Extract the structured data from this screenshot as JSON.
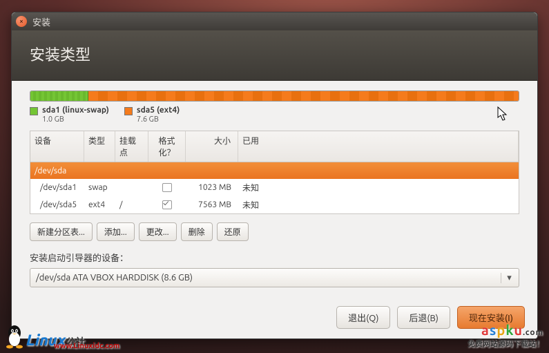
{
  "window": {
    "title": "安装"
  },
  "header": {
    "title": "安装类型"
  },
  "usage": {
    "sda1": {
      "label": "sda1 (linux-swap)",
      "size": "1.0 GB"
    },
    "sda5": {
      "label": "sda5 (ext4)",
      "size": "7.6 GB"
    }
  },
  "columns": {
    "device": "设备",
    "type": "类型",
    "mount": "挂载点",
    "format": "格式化？",
    "size": "大小",
    "used": "已用"
  },
  "rows": {
    "disk": {
      "device": "/dev/sda"
    },
    "p1": {
      "device": "/dev/sda1",
      "type": "swap",
      "mount": "",
      "size": "1023 MB",
      "used": "未知"
    },
    "p2": {
      "device": "/dev/sda5",
      "type": "ext4",
      "mount": "/",
      "size": "7563 MB",
      "used": "未知"
    }
  },
  "tableButtons": {
    "new": "新建分区表...",
    "add": "添加...",
    "change": "更改...",
    "delete": "删除",
    "revert": "还原"
  },
  "bootloader": {
    "label": "安装启动引导器的设备：",
    "value": "/dev/sda    ATA VBOX HARDDISK (8.6 GB)"
  },
  "footer": {
    "quit": "退出(Q)",
    "back": "后退(B)",
    "install": "现在安装(I)"
  },
  "watermarks": {
    "linuxidc": {
      "name": "Linux",
      "suffix": "公社",
      "url": "www.Linuxidc.com"
    },
    "aspku": {
      "domain": "aspku",
      "tld": ".com",
      "tag": "免费网站源码下载站！"
    }
  }
}
